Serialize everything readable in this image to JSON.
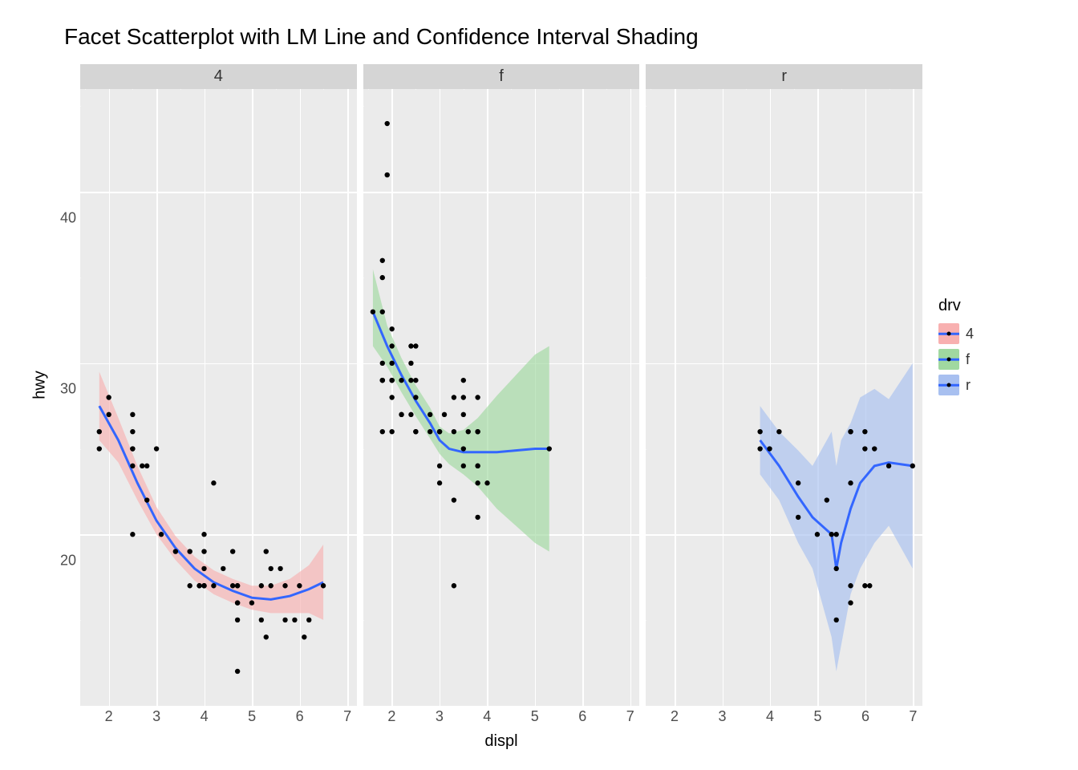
{
  "chart_data": {
    "type": "scatter",
    "title": "Facet Scatterplot with LM Line and Confidence Interval Shading",
    "xlabel": "displ",
    "ylabel": "hwy",
    "xlim": [
      1.4,
      7.2
    ],
    "ylim": [
      10,
      46
    ],
    "x_ticks": [
      2,
      3,
      4,
      5,
      6,
      7
    ],
    "y_ticks": [
      20,
      30,
      40
    ],
    "facets": [
      "4",
      "f",
      "r"
    ],
    "legend": {
      "title": "drv",
      "entries": [
        {
          "label": "4",
          "fill": "#f8b0b0"
        },
        {
          "label": "f",
          "fill": "#a0d8a0"
        },
        {
          "label": "r",
          "fill": "#a8c0f0"
        }
      ]
    },
    "series": [
      {
        "facet": "4",
        "ci_fill": "#f8b0b0",
        "points": [
          [
            1.8,
            26
          ],
          [
            1.8,
            25
          ],
          [
            2.0,
            28
          ],
          [
            2.0,
            27
          ],
          [
            2.5,
            26
          ],
          [
            2.5,
            25
          ],
          [
            2.5,
            27
          ],
          [
            2.5,
            25
          ],
          [
            2.5,
            24
          ],
          [
            2.7,
            24
          ],
          [
            2.5,
            20
          ],
          [
            2.8,
            24
          ],
          [
            2.8,
            22
          ],
          [
            3.0,
            25
          ],
          [
            3.1,
            20
          ],
          [
            3.4,
            19
          ],
          [
            3.7,
            19
          ],
          [
            3.7,
            17
          ],
          [
            3.9,
            17
          ],
          [
            3.9,
            17
          ],
          [
            4.0,
            20
          ],
          [
            4.0,
            18
          ],
          [
            4.0,
            19
          ],
          [
            4.0,
            17
          ],
          [
            4.0,
            17
          ],
          [
            4.0,
            17
          ],
          [
            4.2,
            23
          ],
          [
            4.2,
            17
          ],
          [
            4.4,
            18
          ],
          [
            4.6,
            19
          ],
          [
            4.6,
            17
          ],
          [
            4.7,
            17
          ],
          [
            4.7,
            16
          ],
          [
            4.7,
            12
          ],
          [
            4.7,
            17
          ],
          [
            4.7,
            15
          ],
          [
            4.7,
            16
          ],
          [
            5.0,
            16
          ],
          [
            5.2,
            17
          ],
          [
            5.2,
            15
          ],
          [
            5.3,
            19
          ],
          [
            5.3,
            14
          ],
          [
            5.4,
            17
          ],
          [
            5.4,
            18
          ],
          [
            5.6,
            18
          ],
          [
            5.7,
            17
          ],
          [
            5.7,
            15
          ],
          [
            5.9,
            15
          ],
          [
            6.0,
            17
          ],
          [
            6.1,
            14
          ],
          [
            6.2,
            15
          ],
          [
            6.5,
            17
          ]
        ],
        "smooth": [
          [
            1.8,
            27.5
          ],
          [
            2.2,
            25.5
          ],
          [
            2.6,
            23.0
          ],
          [
            3.0,
            20.8
          ],
          [
            3.4,
            19.2
          ],
          [
            3.8,
            18.0
          ],
          [
            4.2,
            17.2
          ],
          [
            4.6,
            16.7
          ],
          [
            5.0,
            16.3
          ],
          [
            5.4,
            16.2
          ],
          [
            5.8,
            16.4
          ],
          [
            6.2,
            16.8
          ],
          [
            6.5,
            17.2
          ]
        ],
        "ci": [
          [
            1.8,
            25.5,
            29.5
          ],
          [
            2.2,
            24.2,
            26.8
          ],
          [
            2.6,
            22.0,
            24.0
          ],
          [
            3.0,
            20.0,
            21.6
          ],
          [
            3.4,
            18.5,
            19.9
          ],
          [
            3.8,
            17.3,
            18.7
          ],
          [
            4.2,
            16.5,
            17.9
          ],
          [
            4.6,
            16.0,
            17.4
          ],
          [
            5.0,
            15.6,
            17.0
          ],
          [
            5.4,
            15.4,
            17.0
          ],
          [
            5.8,
            15.4,
            17.4
          ],
          [
            6.2,
            15.4,
            18.2
          ],
          [
            6.5,
            15.0,
            19.4
          ]
        ]
      },
      {
        "facet": "f",
        "ci_fill": "#a0d8a0",
        "points": [
          [
            1.6,
            33
          ],
          [
            1.8,
            36
          ],
          [
            1.8,
            29
          ],
          [
            1.8,
            29
          ],
          [
            1.8,
            30
          ],
          [
            1.8,
            26
          ],
          [
            1.8,
            29
          ],
          [
            1.8,
            35
          ],
          [
            1.8,
            33
          ],
          [
            1.9,
            44
          ],
          [
            1.9,
            41
          ],
          [
            2.0,
            31
          ],
          [
            2.0,
            30
          ],
          [
            2.0,
            29
          ],
          [
            2.0,
            29
          ],
          [
            2.0,
            28
          ],
          [
            2.0,
            26
          ],
          [
            2.0,
            29
          ],
          [
            2.0,
            32
          ],
          [
            2.2,
            27
          ],
          [
            2.2,
            29
          ],
          [
            2.2,
            27
          ],
          [
            2.4,
            30
          ],
          [
            2.4,
            31
          ],
          [
            2.4,
            27
          ],
          [
            2.4,
            29
          ],
          [
            2.5,
            29
          ],
          [
            2.5,
            26
          ],
          [
            2.5,
            28
          ],
          [
            2.5,
            31
          ],
          [
            2.5,
            26
          ],
          [
            2.8,
            27
          ],
          [
            2.8,
            26
          ],
          [
            3.0,
            26
          ],
          [
            3.0,
            24
          ],
          [
            3.0,
            26
          ],
          [
            3.0,
            23
          ],
          [
            3.1,
            27
          ],
          [
            3.3,
            28
          ],
          [
            3.3,
            22
          ],
          [
            3.3,
            26
          ],
          [
            3.3,
            17
          ],
          [
            3.5,
            27
          ],
          [
            3.5,
            29
          ],
          [
            3.5,
            25
          ],
          [
            3.5,
            24
          ],
          [
            3.5,
            28
          ],
          [
            3.6,
            26
          ],
          [
            3.8,
            28
          ],
          [
            3.8,
            26
          ],
          [
            3.8,
            24
          ],
          [
            3.8,
            23
          ],
          [
            3.8,
            24
          ],
          [
            3.8,
            26
          ],
          [
            3.8,
            21
          ],
          [
            4.0,
            23
          ],
          [
            5.3,
            25
          ]
        ],
        "smooth": [
          [
            1.6,
            33.0
          ],
          [
            1.9,
            31.0
          ],
          [
            2.2,
            29.3
          ],
          [
            2.5,
            27.8
          ],
          [
            2.8,
            26.5
          ],
          [
            3.0,
            25.5
          ],
          [
            3.2,
            25.0
          ],
          [
            3.5,
            24.8
          ],
          [
            3.8,
            24.8
          ],
          [
            4.2,
            24.8
          ],
          [
            4.6,
            24.9
          ],
          [
            5.0,
            25.0
          ],
          [
            5.3,
            25.0
          ]
        ],
        "ci": [
          [
            1.6,
            31.0,
            35.5
          ],
          [
            1.9,
            29.8,
            32.2
          ],
          [
            2.2,
            28.3,
            30.3
          ],
          [
            2.5,
            26.9,
            28.7
          ],
          [
            2.8,
            25.6,
            27.4
          ],
          [
            3.0,
            24.7,
            26.3
          ],
          [
            3.2,
            24.1,
            25.9
          ],
          [
            3.5,
            23.5,
            26.1
          ],
          [
            3.8,
            22.8,
            26.8
          ],
          [
            4.2,
            21.5,
            28.1
          ],
          [
            4.6,
            20.5,
            29.3
          ],
          [
            5.0,
            19.5,
            30.5
          ],
          [
            5.3,
            19.0,
            31.0
          ]
        ]
      },
      {
        "facet": "r",
        "ci_fill": "#a8c0f0",
        "points": [
          [
            3.8,
            26
          ],
          [
            3.8,
            25
          ],
          [
            4.0,
            25
          ],
          [
            4.2,
            26
          ],
          [
            4.6,
            23
          ],
          [
            4.6,
            21
          ],
          [
            5.0,
            20
          ],
          [
            5.2,
            22
          ],
          [
            5.3,
            20
          ],
          [
            5.4,
            20
          ],
          [
            5.4,
            18
          ],
          [
            5.4,
            15
          ],
          [
            5.7,
            26
          ],
          [
            5.7,
            26
          ],
          [
            5.7,
            16
          ],
          [
            5.7,
            17
          ],
          [
            5.7,
            23
          ],
          [
            6.0,
            26
          ],
          [
            6.0,
            25
          ],
          [
            6.0,
            17
          ],
          [
            6.1,
            17
          ],
          [
            6.2,
            25
          ],
          [
            6.5,
            24
          ],
          [
            7.0,
            24
          ]
        ],
        "smooth": [
          [
            3.8,
            25.5
          ],
          [
            4.2,
            24.0
          ],
          [
            4.6,
            22.2
          ],
          [
            4.9,
            21.0
          ],
          [
            5.1,
            20.5
          ],
          [
            5.3,
            20.0
          ],
          [
            5.4,
            18.0
          ],
          [
            5.5,
            19.5
          ],
          [
            5.7,
            21.5
          ],
          [
            5.9,
            23.0
          ],
          [
            6.2,
            24.0
          ],
          [
            6.5,
            24.2
          ],
          [
            7.0,
            24.0
          ]
        ],
        "ci": [
          [
            3.8,
            23.5,
            27.5
          ],
          [
            4.2,
            22.0,
            26.0
          ],
          [
            4.6,
            19.5,
            24.9
          ],
          [
            4.9,
            18.0,
            24.0
          ],
          [
            5.1,
            16.0,
            25.0
          ],
          [
            5.3,
            14.0,
            26.0
          ],
          [
            5.4,
            12.0,
            24.0
          ],
          [
            5.5,
            13.5,
            25.5
          ],
          [
            5.7,
            16.5,
            26.5
          ],
          [
            5.9,
            18.0,
            28.0
          ],
          [
            6.2,
            19.5,
            28.5
          ],
          [
            6.5,
            20.5,
            27.9
          ],
          [
            7.0,
            18.0,
            30.0
          ]
        ]
      }
    ]
  }
}
